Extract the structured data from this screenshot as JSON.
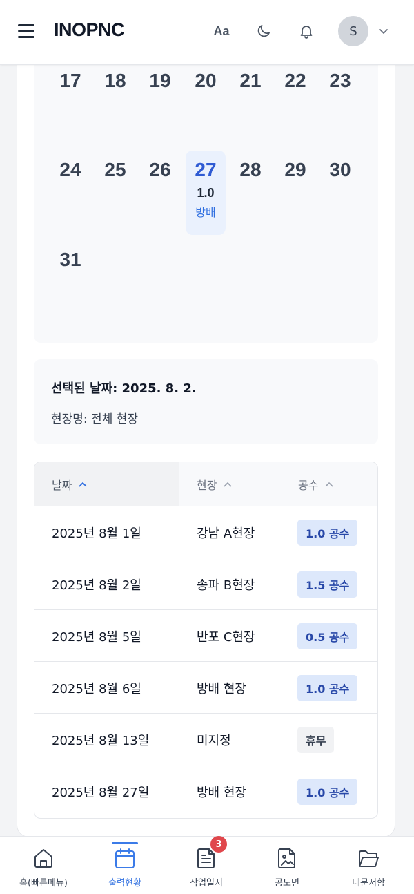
{
  "header": {
    "brand": "INOPNC",
    "font_button": "Aa",
    "avatar_initial": "S"
  },
  "calendar": {
    "days": [
      {
        "day": "17"
      },
      {
        "day": "18"
      },
      {
        "day": "19"
      },
      {
        "day": "20"
      },
      {
        "day": "21"
      },
      {
        "day": "22"
      },
      {
        "day": "23"
      },
      {
        "day": "24"
      },
      {
        "day": "25"
      },
      {
        "day": "26"
      },
      {
        "day": "27",
        "hours": "1.0",
        "site": "방배",
        "highlighted": true
      },
      {
        "day": "28"
      },
      {
        "day": "29"
      },
      {
        "day": "30"
      },
      {
        "day": "31"
      }
    ]
  },
  "info": {
    "selected_date": "선택된 날짜: 2025. 8. 2.",
    "site_name": "현장명: 전체 현장"
  },
  "table": {
    "headers": {
      "date": "날짜",
      "site": "현장",
      "count": "공수"
    },
    "rows": [
      {
        "date": "2025년 8월 1일",
        "site": "강남 A현장",
        "count": "1.0 공수",
        "off": false
      },
      {
        "date": "2025년 8월 2일",
        "site": "송파 B현장",
        "count": "1.5 공수",
        "off": false
      },
      {
        "date": "2025년 8월 5일",
        "site": "반포 C현장",
        "count": "0.5 공수",
        "off": false
      },
      {
        "date": "2025년 8월 6일",
        "site": "방배 현장",
        "count": "1.0 공수",
        "off": false
      },
      {
        "date": "2025년 8월 13일",
        "site": "미지정",
        "count": "휴무",
        "off": true
      },
      {
        "date": "2025년 8월 27일",
        "site": "방배 현장",
        "count": "1.0 공수",
        "off": false
      }
    ]
  },
  "bottom_nav": {
    "items": [
      {
        "label": "홈(빠른메뉴)",
        "icon": "home-icon"
      },
      {
        "label": "출력현황",
        "icon": "calendar-icon",
        "active": true
      },
      {
        "label": "작업일지",
        "icon": "document-icon",
        "badge": "3"
      },
      {
        "label": "공도면",
        "icon": "image-file-icon"
      },
      {
        "label": "내문서함",
        "icon": "folder-icon"
      }
    ]
  },
  "colors": {
    "accent": "#2f6fe0",
    "badge_bg": "#dde8fb",
    "badge_text": "#2848a8",
    "notification": "#e0474c"
  }
}
